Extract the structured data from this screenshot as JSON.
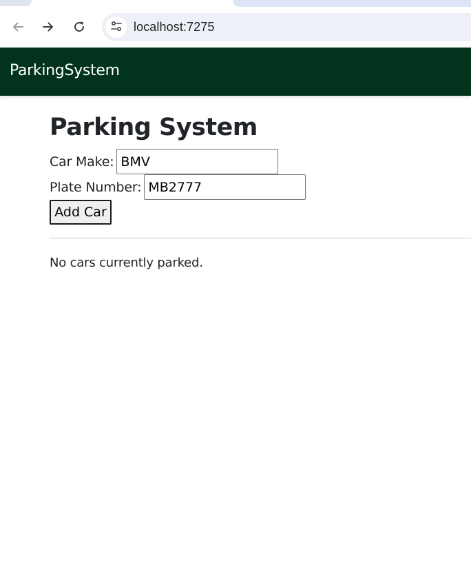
{
  "browser": {
    "url": "localhost:7275",
    "icons": {
      "back": "arrow-left-icon",
      "forward": "arrow-right-icon",
      "reload": "reload-icon",
      "site_info": "tune-icon"
    }
  },
  "navbar": {
    "brand": "ParkingSystem",
    "background_color": "#02331c"
  },
  "main": {
    "title": "Parking System",
    "car_make": {
      "label": "Car Make:",
      "value": "BMV"
    },
    "plate_number": {
      "label": "Plate Number:",
      "value": "MB2777"
    },
    "add_button_label": "Add Car",
    "empty_message": "No cars currently parked."
  }
}
